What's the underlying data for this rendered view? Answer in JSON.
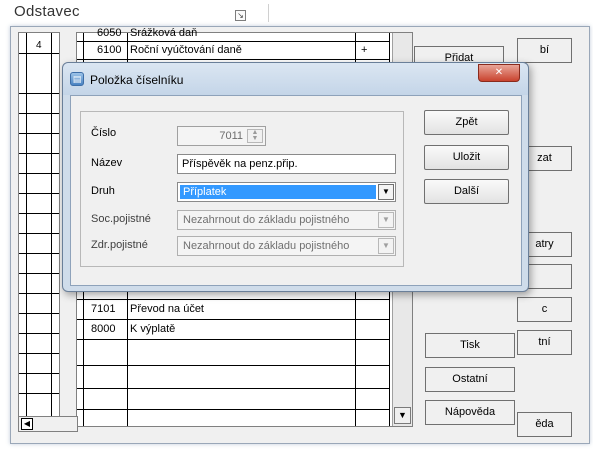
{
  "ribbon": {
    "group_title": "Odstavec",
    "launcher_glyph": "↘"
  },
  "grid": {
    "left_row_number": "4"
  },
  "table": {
    "rows": [
      {
        "code": "6050",
        "name": "Srážková daň",
        "mark": ""
      },
      {
        "code": "6100",
        "name": "Roční vyúčtování daně",
        "mark": "+"
      },
      {
        "code": "7101",
        "name": "Převod na účet",
        "mark": ""
      },
      {
        "code": "8000",
        "name": "K výplatě",
        "mark": ""
      }
    ],
    "scroll_down_glyph": "▼"
  },
  "background_buttons": {
    "pridat": {
      "label": "Přidat"
    },
    "bi": {
      "label": "bí"
    },
    "zat": {
      "label": "zat"
    },
    "atry": {
      "label": "atry"
    },
    "c": {
      "label": "c"
    },
    "tni": {
      "label": "tní"
    },
    "eda": {
      "label": "ěda"
    },
    "tisk": {
      "label": "Tisk"
    },
    "ostatni": {
      "label": "Ostatní"
    },
    "napoveda": {
      "label": "Nápověda"
    }
  },
  "dialog": {
    "title": "Položka číselníku",
    "icon": "form-icon",
    "close_glyph": "✕",
    "fields": {
      "cislo": {
        "label": "Číslo",
        "value": "7011",
        "spin_glyph": "▲▼"
      },
      "nazev": {
        "label": "Název",
        "value": "Příspěvěk na penz.přip."
      },
      "druh": {
        "label": "Druh",
        "value": "Příplatek",
        "dropdown_glyph": "▼"
      },
      "soc": {
        "label": "Soc.pojistné",
        "value": "Nezahrnout do základu pojistného",
        "dropdown_glyph": "▼"
      },
      "zdr": {
        "label": "Zdr.pojistné",
        "value": "Nezahrnout do základu pojistného",
        "dropdown_glyph": "▼"
      }
    },
    "buttons": {
      "zpet": {
        "label": "Zpět"
      },
      "ulozit": {
        "label": "Uložit"
      },
      "dalsi": {
        "label": "Další"
      }
    }
  },
  "colors": {
    "selection": "#3399ff",
    "dialog_frame": "#cfdcea",
    "close_button": "#c9432e"
  }
}
